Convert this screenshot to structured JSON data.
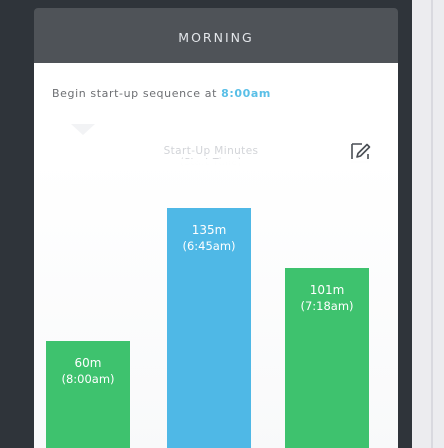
{
  "header": {
    "title": "MORNING"
  },
  "subtitle": {
    "prefix": "Begin start-up sequence at ",
    "time": "8:00am"
  },
  "chart_meta": {
    "axis_label": "Start-Up Minutes",
    "axis_sublabel": "(Start Time)"
  },
  "colors": {
    "blue": "#4fb8e6",
    "green": "#3ec26e",
    "accent_time": "#59bfe7",
    "header_bg": "#4f5358"
  },
  "icons": {
    "edit": "edit-pencil-icon"
  },
  "chart_data": {
    "type": "bar",
    "categories": [
      "(8:00am)",
      "(6:45am)",
      "(7:18am)"
    ],
    "values": [
      60,
      135,
      101
    ],
    "labels": [
      "60m",
      "135m",
      "101m"
    ],
    "colors": [
      "#3ec26e",
      "#4fb8e6",
      "#3ec26e"
    ],
    "ylabel": "Start-Up Minutes"
  }
}
